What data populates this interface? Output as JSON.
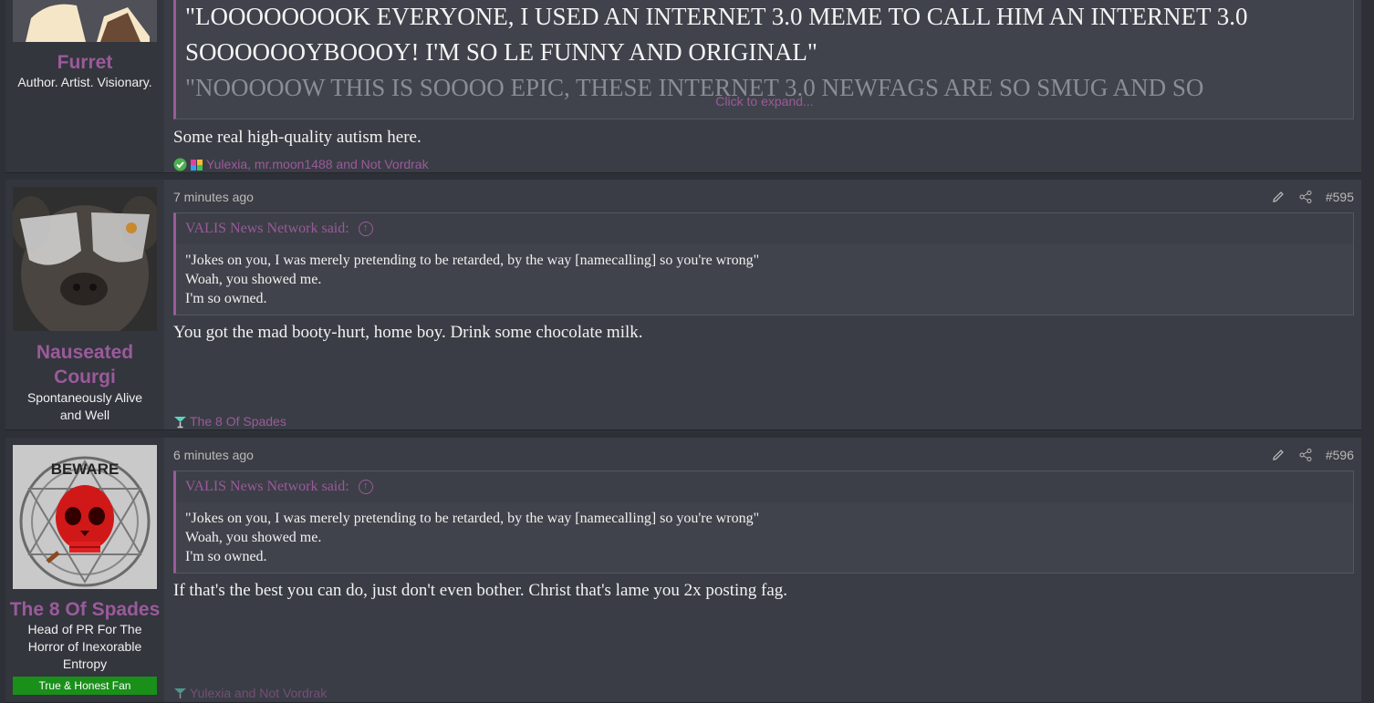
{
  "posts": [
    {
      "username": "Furret",
      "user_title": "Author. Artist. Visionary.",
      "quote_lines": [
        "\"LOOOOOOOOK EVERYONE, I USED AN INTERNET 3.0 MEME TO CALL HIM AN INTERNET 3.0",
        "SOOOOOOYBOOOY! I'M SO LE FUNNY AND ORIGINAL\"",
        "\"NOOOOOW THIS IS SOOOO EPIC, THESE INTERNET 3.0 NEWFAGS ARE SO SMUG AND SO"
      ],
      "expand_label": "Click to expand...",
      "body": "Some real high-quality autism here.",
      "reactions": "Yulexia, mr.moon1488 and Not Vordrak"
    },
    {
      "username_line1": "Nauseated",
      "username_line2": "Courgi",
      "user_title_line1": "Spontaneously Alive",
      "user_title_line2": "and Well",
      "time": "7 minutes ago",
      "post_number": "#595",
      "quote_author": "VALIS News Network said:",
      "quote_lines": [
        "\"Jokes on you, I was merely pretending to be retarded, by the way [namecalling] so you're wrong\"",
        "Woah, you showed me.",
        "I'm so owned."
      ],
      "body": "You got the mad booty-hurt, home boy. Drink some chocolate milk.",
      "reactions": "The 8 Of Spades"
    },
    {
      "username": "The 8 Of Spades",
      "user_title_line1": "Head of PR For The",
      "user_title_line2": "Horror of Inexorable",
      "user_title_line3": "Entropy",
      "banner": "True & Honest Fan",
      "avatar_text": "BEWARE",
      "time": "6 minutes ago",
      "post_number": "#596",
      "quote_author": "VALIS News Network said:",
      "quote_lines": [
        "\"Jokes on you, I was merely pretending to be retarded, by the way [namecalling] so you're wrong\"",
        "Woah, you showed me.",
        "I'm so owned."
      ],
      "body": "If that's the best you can do, just don't even bother. Christ that's lame you 2x posting fag.",
      "reactions": "Yulexia and Not Vordrak"
    }
  ],
  "colors": {
    "page_bg": "#2d3037",
    "post_bg": "#3a3d45",
    "sidebar_bg": "#33363d",
    "accent": "#9b5a9b",
    "banner_green": "#1a8f1a"
  },
  "icons": [
    "edit-icon",
    "share-icon",
    "quote-up-arrow-icon",
    "checkmark-reaction-icon",
    "puzzle-reaction-icon",
    "cocktail-reaction-icon"
  ]
}
